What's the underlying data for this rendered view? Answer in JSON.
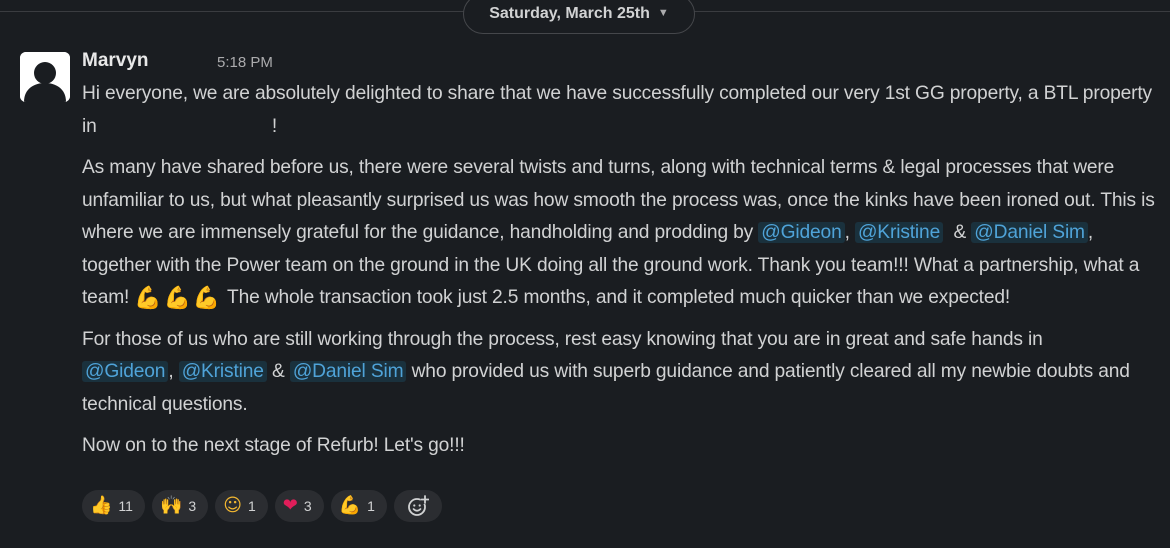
{
  "day_divider": {
    "label": "Saturday, March 25th",
    "chevron": "chevron-down-icon"
  },
  "message": {
    "sender": "Marvyn",
    "timestamp": "5:18 PM",
    "avatar_icon": "default-user-avatar",
    "p1_text": "Hi everyone, we are absolutely delighted to share that we have successfully completed our very 1st GG property, a BTL property in ",
    "p1_end": "!",
    "p2_text1": "As many have shared before us, there were several twists and turns, along with technical terms & legal processes that were unfamiliar to us, but what pleasantly surprised us was how smooth the process was, once the kinks have been ironed out. This is where we are immensely grateful for the guidance, handholding and prodding by ",
    "p2_sep1": ",",
    "p2_sep2": "  & ",
    "p2_text2": ", together with the Power team on the ground in the UK doing all the ground work. Thank you team!!! What a partnership, what a team! ",
    "p2_emojis": [
      "flexed-biceps",
      "flexed-biceps",
      "flexed-biceps"
    ],
    "p2_text3": " The whole transaction took just 2.5 months, and it completed much quicker than we expected!",
    "p3_text1": "For those of us who are still working through the process, rest easy knowing that you are in great and safe hands in ",
    "p3_sep1": ", ",
    "p3_sep2": " & ",
    "p3_text2": " who provided us with superb guidance and patiently cleared all my newbie doubts and technical questions.",
    "p4_text": "Now on to the next stage of Refurb! Let's go!!!",
    "mentions": {
      "gideon": "@Gideon",
      "kristine": "@Kristine",
      "daniel": "@Daniel Sim"
    }
  },
  "reactions": [
    {
      "emoji": "👍",
      "name": "thumbs-up",
      "count": "11"
    },
    {
      "emoji": "🙌",
      "name": "raising-hands",
      "count": "3"
    },
    {
      "emoji": "☺",
      "name": "smiling-face",
      "count": "1"
    },
    {
      "emoji": "❤",
      "name": "red-heart",
      "count": "3"
    },
    {
      "emoji": "💪",
      "name": "flexed-biceps",
      "count": "1"
    }
  ],
  "add_reaction_icon": "add-reaction-icon",
  "colors": {
    "background": "#1a1d21",
    "text": "#d1d2d3",
    "mention": "#4fa3d8",
    "reaction_pill": "#2b2d31",
    "heart": "#e01e5a",
    "emoji_yellow": "#f2b731"
  }
}
